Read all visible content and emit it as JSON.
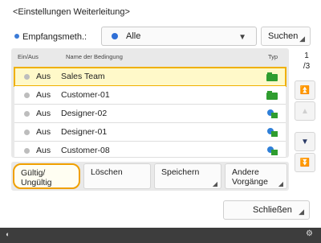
{
  "title": "<Einstellungen Weiterleitung>",
  "filter": {
    "label": "Empfangsmeth.:",
    "selected": "Alle",
    "search_label": "Suchen"
  },
  "list": {
    "headers": {
      "col1": "Ein/Aus",
      "col2": "Name der Bedingung",
      "col3": "Typ"
    },
    "rows": [
      {
        "status": "Aus",
        "name": "Sales Team",
        "selected": true,
        "type_icon": "folder-green-icon"
      },
      {
        "status": "Aus",
        "name": "Customer-01",
        "selected": false,
        "type_icon": "folder-green-icon"
      },
      {
        "status": "Aus",
        "name": "Designer-02",
        "selected": false,
        "type_icon": "network-folder-icon"
      },
      {
        "status": "Aus",
        "name": "Designer-01",
        "selected": false,
        "type_icon": "network-folder-icon"
      },
      {
        "status": "Aus",
        "name": "Customer-08",
        "selected": false,
        "type_icon": "network-folder-icon"
      }
    ]
  },
  "pager": {
    "current": "1",
    "total": "/3"
  },
  "actions": {
    "toggle": "Gültig/\nUngültig",
    "delete": "Löschen",
    "save": "Speichern",
    "other": "Andere\nVorgänge"
  },
  "close_label": "Schließen",
  "colors": {
    "accent": "#f0b000",
    "blue": "#2f6fd6",
    "footer": "#3d3d3d"
  }
}
